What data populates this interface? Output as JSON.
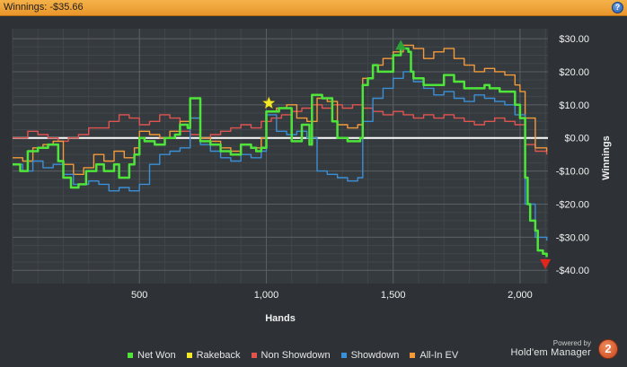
{
  "window": {
    "title": "Winnings: -$35.66",
    "help_icon": "question-mark-icon",
    "help_label": "?"
  },
  "branding": {
    "powered_by": "Powered by",
    "product": "Hold'em Manager",
    "badge": "2"
  },
  "chart_data": {
    "type": "line",
    "xlabel": "Hands",
    "ylabel": "Winnings",
    "xlim": [
      0,
      2110
    ],
    "ylim": [
      -44,
      33
    ],
    "x_ticks": [
      500,
      1000,
      1500,
      2000
    ],
    "x_tick_labels": [
      "500",
      "1,000",
      "1,500",
      "2,000"
    ],
    "y_ticks": [
      30,
      20,
      10,
      0,
      -10,
      -20,
      -30,
      -40
    ],
    "y_tick_labels": [
      "$30.00",
      "$20.00",
      "$10.00",
      "$0.00",
      "-$10.00",
      "-$20.00",
      "-$30.00",
      "-$40.00"
    ],
    "grid": true,
    "zero_line": true,
    "legend_position": "bottom",
    "series": [
      {
        "name": "Net Won",
        "color": "#4ee43a",
        "points": [
          [
            0,
            -8
          ],
          [
            30,
            -10
          ],
          [
            60,
            -4
          ],
          [
            100,
            -3
          ],
          [
            140,
            -2
          ],
          [
            180,
            -7
          ],
          [
            200,
            -12
          ],
          [
            230,
            -15
          ],
          [
            260,
            -14
          ],
          [
            290,
            -10
          ],
          [
            330,
            -8
          ],
          [
            360,
            -10
          ],
          [
            400,
            -8
          ],
          [
            420,
            -12
          ],
          [
            460,
            -8
          ],
          [
            480,
            -5
          ],
          [
            500,
            0
          ],
          [
            520,
            -1
          ],
          [
            560,
            -2
          ],
          [
            600,
            0
          ],
          [
            640,
            1
          ],
          [
            660,
            4
          ],
          [
            690,
            3
          ],
          [
            700,
            12
          ],
          [
            720,
            12
          ],
          [
            740,
            -1
          ],
          [
            780,
            -2
          ],
          [
            820,
            -4
          ],
          [
            860,
            -5
          ],
          [
            900,
            -2
          ],
          [
            940,
            -3
          ],
          [
            960,
            -4
          ],
          [
            980,
            -3
          ],
          [
            1000,
            8
          ],
          [
            1050,
            9
          ],
          [
            1090,
            9
          ],
          [
            1100,
            -1
          ],
          [
            1120,
            -1
          ],
          [
            1140,
            4
          ],
          [
            1170,
            -2
          ],
          [
            1180,
            13
          ],
          [
            1220,
            12
          ],
          [
            1250,
            12
          ],
          [
            1260,
            5
          ],
          [
            1280,
            0
          ],
          [
            1320,
            -1
          ],
          [
            1340,
            -1
          ],
          [
            1370,
            0
          ],
          [
            1380,
            16
          ],
          [
            1400,
            18
          ],
          [
            1420,
            22
          ],
          [
            1440,
            20
          ],
          [
            1480,
            20
          ],
          [
            1500,
            25
          ],
          [
            1530,
            27
          ],
          [
            1560,
            26
          ],
          [
            1570,
            20
          ],
          [
            1580,
            18
          ],
          [
            1620,
            16
          ],
          [
            1660,
            16
          ],
          [
            1700,
            19
          ],
          [
            1740,
            17
          ],
          [
            1780,
            15
          ],
          [
            1820,
            15
          ],
          [
            1860,
            16
          ],
          [
            1880,
            15
          ],
          [
            1920,
            14
          ],
          [
            1960,
            14
          ],
          [
            1980,
            10
          ],
          [
            2000,
            6
          ],
          [
            2020,
            -12
          ],
          [
            2030,
            -20
          ],
          [
            2040,
            -25
          ],
          [
            2060,
            -28
          ],
          [
            2070,
            -34
          ],
          [
            2090,
            -35
          ],
          [
            2105,
            -36
          ]
        ]
      },
      {
        "name": "Rakeback",
        "color": "#f4ea2a",
        "points": [
          [
            0,
            0
          ],
          [
            2105,
            0
          ]
        ]
      },
      {
        "name": "Non Showdown",
        "color": "#e05450",
        "points": [
          [
            0,
            0
          ],
          [
            60,
            2
          ],
          [
            100,
            1
          ],
          [
            140,
            0
          ],
          [
            180,
            -1
          ],
          [
            220,
            0
          ],
          [
            260,
            1
          ],
          [
            300,
            3
          ],
          [
            340,
            3
          ],
          [
            380,
            5
          ],
          [
            420,
            7
          ],
          [
            460,
            6
          ],
          [
            500,
            4
          ],
          [
            540,
            5
          ],
          [
            580,
            7
          ],
          [
            620,
            6
          ],
          [
            660,
            2
          ],
          [
            700,
            1
          ],
          [
            740,
            0
          ],
          [
            780,
            1
          ],
          [
            820,
            2
          ],
          [
            860,
            3
          ],
          [
            900,
            4
          ],
          [
            940,
            3
          ],
          [
            980,
            5
          ],
          [
            1020,
            6
          ],
          [
            1060,
            7
          ],
          [
            1100,
            8
          ],
          [
            1140,
            9
          ],
          [
            1180,
            10
          ],
          [
            1220,
            9
          ],
          [
            1260,
            10
          ],
          [
            1300,
            9
          ],
          [
            1340,
            10
          ],
          [
            1380,
            9
          ],
          [
            1420,
            8
          ],
          [
            1460,
            7
          ],
          [
            1500,
            8
          ],
          [
            1540,
            7
          ],
          [
            1580,
            6
          ],
          [
            1620,
            7
          ],
          [
            1660,
            6
          ],
          [
            1700,
            7
          ],
          [
            1740,
            6
          ],
          [
            1780,
            5
          ],
          [
            1820,
            4
          ],
          [
            1860,
            5
          ],
          [
            1900,
            6
          ],
          [
            1940,
            5
          ],
          [
            1980,
            4
          ],
          [
            2020,
            -2
          ],
          [
            2060,
            -4
          ],
          [
            2105,
            -5
          ]
        ]
      },
      {
        "name": "Showdown",
        "color": "#3b8fd6",
        "points": [
          [
            0,
            -8
          ],
          [
            40,
            -10
          ],
          [
            80,
            -7
          ],
          [
            120,
            -9
          ],
          [
            160,
            -8
          ],
          [
            200,
            -11
          ],
          [
            240,
            -14
          ],
          [
            300,
            -13
          ],
          [
            340,
            -14
          ],
          [
            380,
            -16
          ],
          [
            420,
            -15
          ],
          [
            460,
            -16
          ],
          [
            500,
            -14
          ],
          [
            540,
            -8
          ],
          [
            580,
            -5
          ],
          [
            620,
            -4
          ],
          [
            660,
            -3
          ],
          [
            700,
            6
          ],
          [
            740,
            -2
          ],
          [
            780,
            -4
          ],
          [
            820,
            -6
          ],
          [
            860,
            -7
          ],
          [
            900,
            -5
          ],
          [
            940,
            -6
          ],
          [
            980,
            -4
          ],
          [
            1000,
            7
          ],
          [
            1040,
            2
          ],
          [
            1080,
            1
          ],
          [
            1120,
            2
          ],
          [
            1160,
            0
          ],
          [
            1200,
            -10
          ],
          [
            1240,
            -11
          ],
          [
            1280,
            -12
          ],
          [
            1320,
            -13
          ],
          [
            1360,
            -12
          ],
          [
            1380,
            5
          ],
          [
            1420,
            12
          ],
          [
            1460,
            15
          ],
          [
            1500,
            18
          ],
          [
            1540,
            20
          ],
          [
            1580,
            17
          ],
          [
            1620,
            15
          ],
          [
            1660,
            13
          ],
          [
            1700,
            14
          ],
          [
            1740,
            12
          ],
          [
            1780,
            11
          ],
          [
            1820,
            13
          ],
          [
            1860,
            12
          ],
          [
            1900,
            11
          ],
          [
            1940,
            10
          ],
          [
            1980,
            7
          ],
          [
            2020,
            -20
          ],
          [
            2060,
            -30
          ],
          [
            2105,
            -31
          ]
        ]
      },
      {
        "name": "All-In EV",
        "color": "#f39a3a",
        "points": [
          [
            0,
            -6
          ],
          [
            40,
            -7
          ],
          [
            80,
            -3
          ],
          [
            120,
            -2
          ],
          [
            160,
            -1
          ],
          [
            200,
            -8
          ],
          [
            240,
            -11
          ],
          [
            280,
            -9
          ],
          [
            320,
            -5
          ],
          [
            360,
            -7
          ],
          [
            400,
            -4
          ],
          [
            440,
            -6
          ],
          [
            480,
            -3
          ],
          [
            500,
            2
          ],
          [
            540,
            1
          ],
          [
            580,
            0
          ],
          [
            620,
            2
          ],
          [
            660,
            5
          ],
          [
            700,
            6
          ],
          [
            740,
            0
          ],
          [
            780,
            -1
          ],
          [
            820,
            -3
          ],
          [
            860,
            -4
          ],
          [
            900,
            -2
          ],
          [
            940,
            -3
          ],
          [
            980,
            0
          ],
          [
            1000,
            8
          ],
          [
            1040,
            9
          ],
          [
            1080,
            10
          ],
          [
            1120,
            6
          ],
          [
            1160,
            5
          ],
          [
            1200,
            12
          ],
          [
            1240,
            11
          ],
          [
            1280,
            4
          ],
          [
            1320,
            3
          ],
          [
            1360,
            4
          ],
          [
            1380,
            18
          ],
          [
            1420,
            22
          ],
          [
            1460,
            24
          ],
          [
            1500,
            26
          ],
          [
            1540,
            28
          ],
          [
            1580,
            27
          ],
          [
            1620,
            24
          ],
          [
            1660,
            26
          ],
          [
            1700,
            27
          ],
          [
            1740,
            24
          ],
          [
            1780,
            22
          ],
          [
            1820,
            20
          ],
          [
            1860,
            21
          ],
          [
            1900,
            20
          ],
          [
            1940,
            19
          ],
          [
            1980,
            16
          ],
          [
            2000,
            14
          ],
          [
            2020,
            6
          ],
          [
            2060,
            -3
          ],
          [
            2105,
            -4
          ]
        ]
      }
    ],
    "markers": [
      {
        "label": "Rakeback star",
        "x": 1010,
        "y": 10.5,
        "shape": "star",
        "color": "#f4ea2a"
      },
      {
        "label": "High point",
        "x": 1530,
        "y": 28,
        "shape": "triangle-up",
        "color": "#2ea236"
      },
      {
        "label": "Low point",
        "x": 2100,
        "y": -38,
        "shape": "triangle-down",
        "color": "#e2261e"
      }
    ]
  }
}
